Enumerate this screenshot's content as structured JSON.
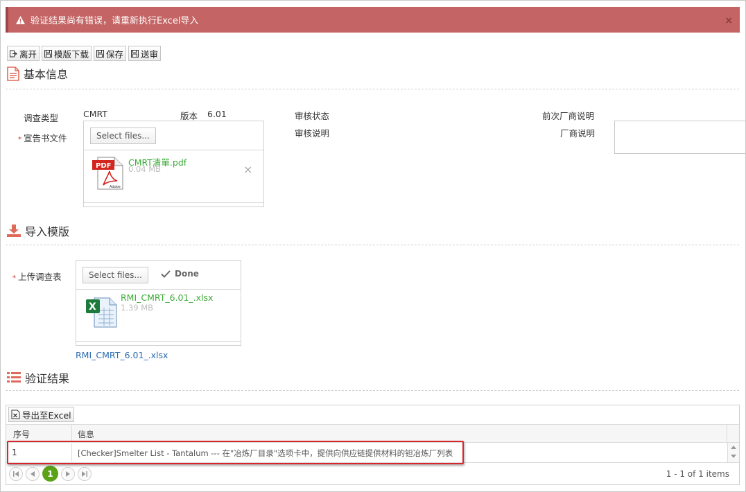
{
  "alert": {
    "message": "验证结果尚有错误，请重新执行Excel导入",
    "close": "×"
  },
  "toolbar": {
    "leave": "离开",
    "template_download": "模版下载",
    "save": "保存",
    "submit": "送审"
  },
  "basic": {
    "heading": "基本信息",
    "survey_type_label": "调查类型",
    "survey_type_value": "CMRT",
    "version_label": "版本",
    "version_value": "6.01",
    "review_status_label": "审核状态",
    "review_note_label": "审核说明",
    "prev_vendor_note_label": "前次厂商说明",
    "vendor_note_label": "厂商说明",
    "declaration_label": "宣告书文件",
    "select_files": "Select files...",
    "file_name": "CMRT清單.pdf",
    "file_size": "0.04 MB",
    "remove": "×"
  },
  "import": {
    "heading": "导入模版",
    "upload_label": "上传调查表",
    "select_files": "Select files...",
    "done": "Done",
    "file_name": "RMI_CMRT_6.01_.xlsx",
    "file_size": "1.39 MB",
    "link": "RMI_CMRT_6.01_.xlsx"
  },
  "validation": {
    "heading": "验证结果",
    "export": "导出至Excel",
    "columns": [
      "序号",
      "信息"
    ],
    "rows": [
      {
        "no": "1",
        "info": "[Checker]Smelter List - Tantalum --- 在\"冶炼厂目录\"选项卡中，提供向供应链提供材料的钽冶炼厂列表"
      }
    ],
    "pager": {
      "current": "1",
      "info": "1 - 1 of 1 items"
    }
  },
  "colors": {
    "alert_bg": "#c46464",
    "success": "#3aaa35",
    "pager_active": "#5aa317",
    "highlight": "#d9262b"
  }
}
